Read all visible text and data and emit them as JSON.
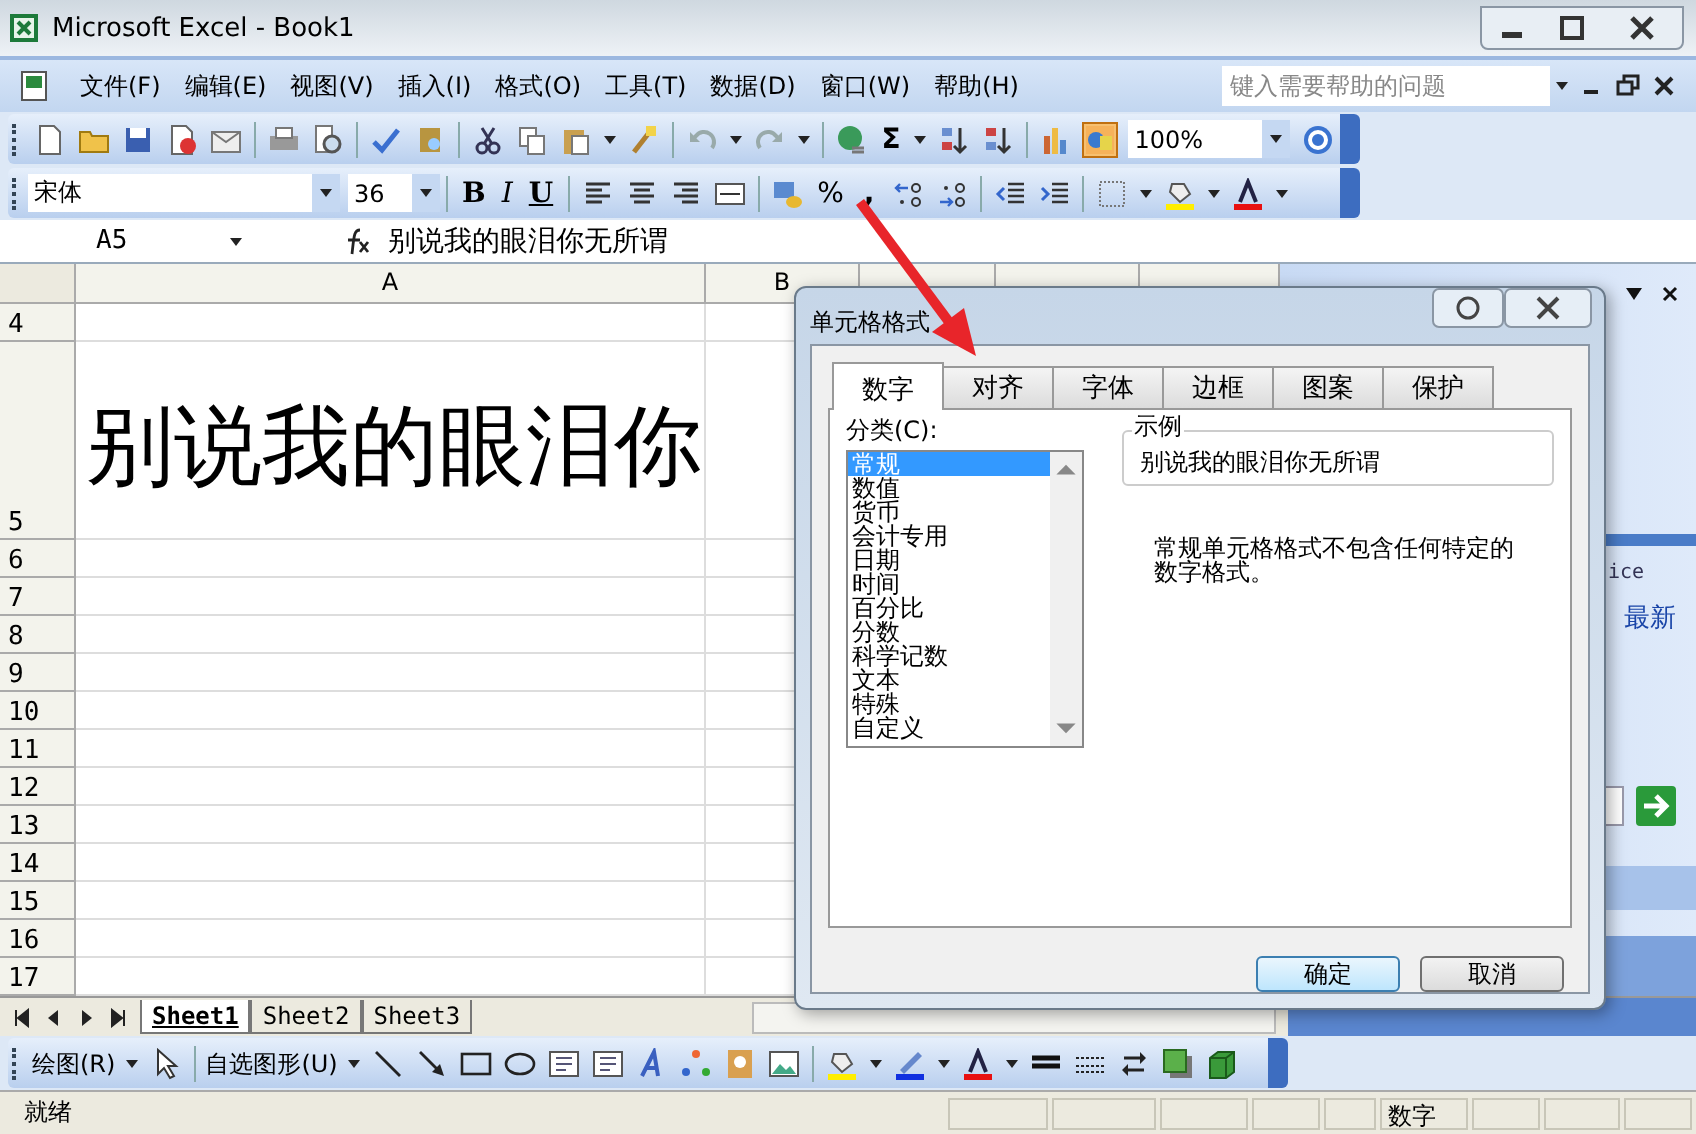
{
  "window": {
    "title": "Microsoft Excel - Book1"
  },
  "menu": [
    "文件(F)",
    "编辑(E)",
    "视图(V)",
    "插入(I)",
    "格式(O)",
    "工具(T)",
    "数据(D)",
    "窗口(W)",
    "帮助(H)"
  ],
  "help_search": {
    "placeholder": "键入需要帮助的问题"
  },
  "standard_toolbar": {
    "autosum": "Σ",
    "zoom": "100%"
  },
  "formatting_toolbar": {
    "font": "宋体",
    "size": "36",
    "bold": "B",
    "italic": "I",
    "underline": "U",
    "percent": "%",
    "comma": ","
  },
  "formula_bar": {
    "name_box": "A5",
    "value": "别说我的眼泪你无所谓"
  },
  "sheet": {
    "columns": [
      "A",
      "B"
    ],
    "rows": [
      {
        "header": "4"
      },
      {
        "header": "5",
        "cell_a": "别说我的眼泪你"
      },
      {
        "header": "6"
      },
      {
        "header": "7"
      },
      {
        "header": "8"
      },
      {
        "header": "9"
      },
      {
        "header": "10"
      },
      {
        "header": "11"
      },
      {
        "header": "12"
      },
      {
        "header": "13"
      },
      {
        "header": "14"
      },
      {
        "header": "15"
      },
      {
        "header": "16"
      },
      {
        "header": "17"
      }
    ]
  },
  "task_pane": {
    "fragment_1": "ice",
    "fragment_2": "最新"
  },
  "sheet_tabs": [
    {
      "label": "Sheet1",
      "selected": true
    },
    {
      "label": "Sheet2",
      "selected": false
    },
    {
      "label": "Sheet3",
      "selected": false
    }
  ],
  "drawing_toolbar": {
    "draw_menu": "绘图(R)",
    "autoshapes_menu": "自选图形(U)"
  },
  "status_bar": {
    "status": "就绪",
    "mode": "数字"
  },
  "dialog": {
    "title": "单元格格式",
    "tabs": [
      {
        "label": "数字",
        "selected": true
      },
      {
        "label": "对齐",
        "selected": false
      },
      {
        "label": "字体",
        "selected": false
      },
      {
        "label": "边框",
        "selected": false
      },
      {
        "label": "图案",
        "selected": false
      },
      {
        "label": "保护",
        "selected": false
      }
    ],
    "category_label": "分类(C):",
    "categories": [
      {
        "label": "常规",
        "selected": true
      },
      {
        "label": "数值",
        "selected": false
      },
      {
        "label": "货币",
        "selected": false
      },
      {
        "label": "会计专用",
        "selected": false
      },
      {
        "label": "日期",
        "selected": false
      },
      {
        "label": "时间",
        "selected": false
      },
      {
        "label": "百分比",
        "selected": false
      },
      {
        "label": "分数",
        "selected": false
      },
      {
        "label": "科学记数",
        "selected": false
      },
      {
        "label": "文本",
        "selected": false
      },
      {
        "label": "特殊",
        "selected": false
      },
      {
        "label": "自定义",
        "selected": false
      }
    ],
    "sample_label": "示例",
    "sample_value": "别说我的眼泪你无所谓",
    "description": "常规单元格格式不包含任何特定的数字格式。",
    "buttons": [
      "确定",
      "取消"
    ]
  }
}
